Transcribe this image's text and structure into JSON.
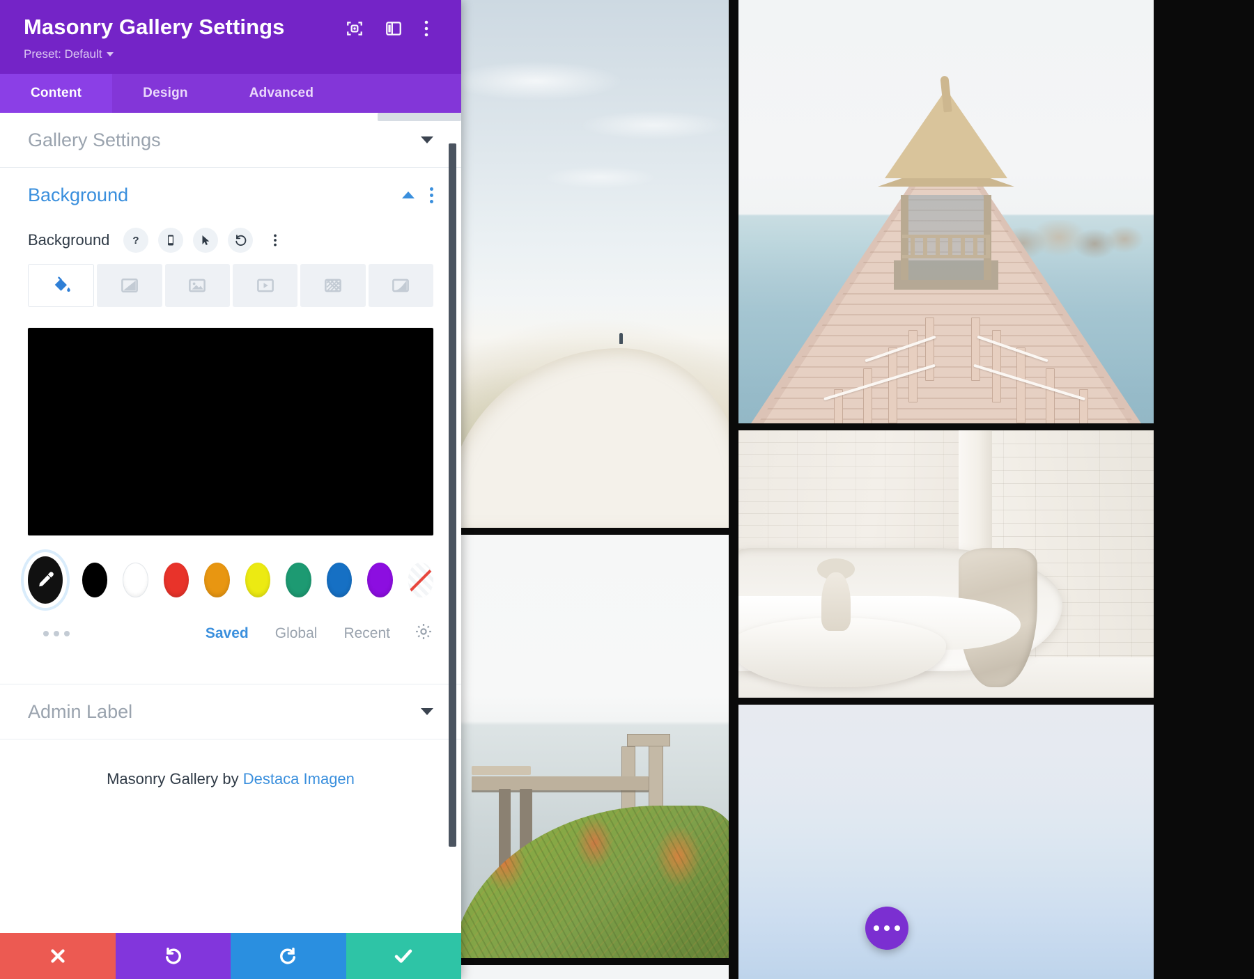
{
  "panel": {
    "title": "Masonry Gallery Settings",
    "preset_label": "Preset: Default",
    "header_icons": [
      {
        "name": "focus-target-icon",
        "label": "Focus"
      },
      {
        "name": "layout-panel-icon",
        "label": "Layout"
      },
      {
        "name": "more-options-icon",
        "label": "More Options"
      }
    ],
    "tabs": [
      {
        "label": "Content",
        "active": true
      },
      {
        "label": "Design",
        "active": false
      },
      {
        "label": "Advanced",
        "active": false
      }
    ],
    "sections": [
      {
        "name": "gallery-settings",
        "label": "Gallery Settings",
        "open": false
      },
      {
        "name": "background",
        "label": "Background",
        "open": true
      },
      {
        "name": "admin-label",
        "label": "Admin Label",
        "open": false
      }
    ],
    "background": {
      "field_label": "Background",
      "field_icons": [
        {
          "name": "help-icon",
          "glyph": "?"
        },
        {
          "name": "responsive-mobile-icon",
          "glyph": "mobile"
        },
        {
          "name": "hover-cursor-icon",
          "glyph": "cursor"
        },
        {
          "name": "reset-icon",
          "glyph": "undo"
        },
        {
          "name": "more-options-icon",
          "glyph": "kebab"
        }
      ],
      "type_tabs": [
        {
          "name": "background-color-tab",
          "label": "Color",
          "active": true
        },
        {
          "name": "background-gradient-tab",
          "label": "Gradient",
          "active": false
        },
        {
          "name": "background-image-tab",
          "label": "Image",
          "active": false
        },
        {
          "name": "background-video-tab",
          "label": "Video",
          "active": false
        },
        {
          "name": "background-pattern-tab",
          "label": "Pattern",
          "active": false
        },
        {
          "name": "background-mask-tab",
          "label": "Mask",
          "active": false
        }
      ],
      "current_color": "#000000",
      "swatches": [
        {
          "name": "eyedropper-swatch",
          "color": "#111111",
          "selected": true
        },
        {
          "name": "swatch-black",
          "color": "#000000",
          "selected": false
        },
        {
          "name": "swatch-white",
          "color": "#ffffff",
          "selected": false
        },
        {
          "name": "swatch-red",
          "color": "#e8332a",
          "selected": false
        },
        {
          "name": "swatch-orange",
          "color": "#e89611",
          "selected": false
        },
        {
          "name": "swatch-yellow",
          "color": "#ecea12",
          "selected": false
        },
        {
          "name": "swatch-teal",
          "color": "#1d9a72",
          "selected": false
        },
        {
          "name": "swatch-blue",
          "color": "#1670c4",
          "selected": false
        },
        {
          "name": "swatch-purple",
          "color": "#8c0ee0",
          "selected": false
        },
        {
          "name": "swatch-transparent",
          "color": "transparent",
          "selected": false
        }
      ],
      "palette_tabs": [
        {
          "label": "Saved",
          "active": true
        },
        {
          "label": "Global",
          "active": false
        },
        {
          "label": "Recent",
          "active": false
        }
      ],
      "settings_gear": "gear-icon"
    },
    "credit": {
      "prefix": "Masonry Gallery by ",
      "link_text": "Destaca Imagen"
    },
    "footer_buttons": [
      {
        "name": "cancel-button",
        "icon": "close-icon",
        "color": "#ec5a52"
      },
      {
        "name": "undo-button",
        "icon": "undo-icon",
        "color": "#8236dc"
      },
      {
        "name": "redo-button",
        "icon": "redo-icon",
        "color": "#2a8fe0"
      },
      {
        "name": "save-button",
        "icon": "check-icon",
        "color": "#2ec4a6"
      }
    ]
  },
  "gallery": {
    "fab": {
      "name": "gallery-options-fab",
      "icon": "three-dots-icon",
      "color": "#7b2fd1"
    },
    "tiles": [
      {
        "name": "gallery-image-dune",
        "alt": "White sand dune beach with scrub grass"
      },
      {
        "name": "gallery-image-pier",
        "alt": "Thatched gazebo at end of wooden pier over sea"
      },
      {
        "name": "gallery-image-cliff",
        "alt": "Wooden bench on succulent-covered cliff above sea"
      },
      {
        "name": "gallery-image-room",
        "alt": "White brick room with curved white sofa and marble table"
      },
      {
        "name": "gallery-image-sky",
        "alt": "Pale blue sky gradient"
      },
      {
        "name": "gallery-image-partial",
        "alt": "Partially visible image"
      }
    ]
  }
}
